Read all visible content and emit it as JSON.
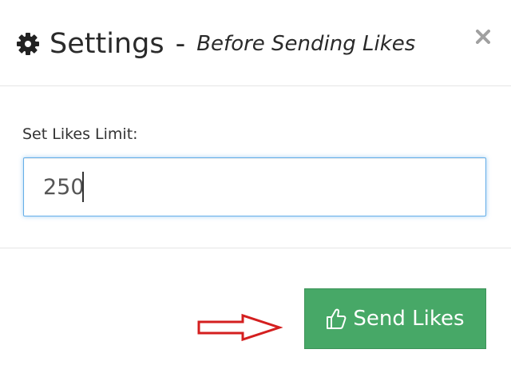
{
  "header": {
    "icon": "gear-icon",
    "title": "Settings",
    "separator": "-",
    "subtitle": "Before Sending Likes",
    "close_icon": "close-icon",
    "close_label": "×"
  },
  "form": {
    "label": "Set Likes Limit:",
    "value": "250"
  },
  "footer": {
    "arrow_icon": "arrow-right-icon",
    "arrow_color": "#d41f1f",
    "button_icon": "thumbs-up-icon",
    "button_label": "Send Likes",
    "button_color": "#47a867"
  }
}
